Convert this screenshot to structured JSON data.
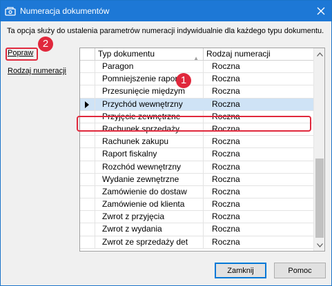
{
  "window": {
    "title": "Numeracja dokumentów"
  },
  "description": "Ta opcja służy do ustalenia parametrów numeracji indywidualnie dla każdego typu dokumentu.",
  "side_links": [
    {
      "label": "Popraw"
    },
    {
      "label": "Rodzaj numeracji"
    }
  ],
  "badges": {
    "one": "1",
    "two": "2"
  },
  "grid": {
    "columns": [
      "Typ dokumentu",
      "Rodzaj numeracji"
    ],
    "rows": [
      {
        "type": "Paragon",
        "numbering": "Roczna"
      },
      {
        "type": "Pomniejszenie raportu f",
        "numbering": "Roczna"
      },
      {
        "type": "Przesunięcie międzym",
        "numbering": "Roczna"
      },
      {
        "type": "Przychód wewnętrzny",
        "numbering": "Roczna"
      },
      {
        "type": "Przyjęcie zewnętrzne",
        "numbering": "Roczna"
      },
      {
        "type": "Rachunek sprzedaży",
        "numbering": "Roczna"
      },
      {
        "type": "Rachunek zakupu",
        "numbering": "Roczna"
      },
      {
        "type": "Raport fiskalny",
        "numbering": "Roczna"
      },
      {
        "type": "Rozchód wewnętrzny",
        "numbering": "Roczna"
      },
      {
        "type": "Wydanie zewnętrzne",
        "numbering": "Roczna"
      },
      {
        "type": "Zamówienie do dostaw",
        "numbering": "Roczna"
      },
      {
        "type": "Zamówienie od klienta",
        "numbering": "Roczna"
      },
      {
        "type": "Zwrot z przyjęcia",
        "numbering": "Roczna"
      },
      {
        "type": "Zwrot z wydania",
        "numbering": "Roczna"
      },
      {
        "type": "Zwrot ze sprzedaży det",
        "numbering": "Roczna"
      }
    ],
    "selected_index": 3
  },
  "buttons": {
    "close": "Zamknij",
    "help": "Pomoc"
  },
  "colors": {
    "titlebar": "#1d78d6",
    "annotation": "#e0283c",
    "selection": "#cfe3f6"
  }
}
